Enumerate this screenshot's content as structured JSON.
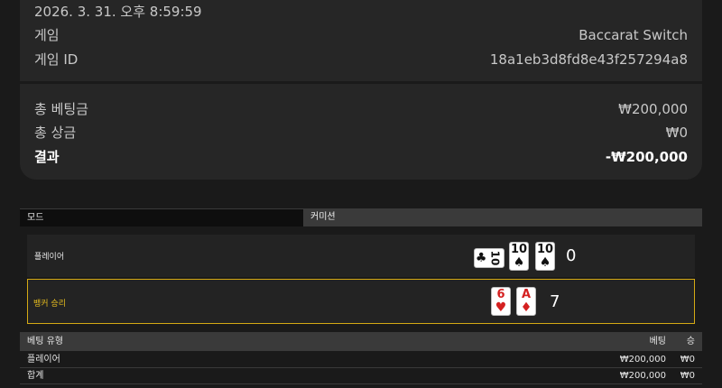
{
  "summary": {
    "datetime": "2026. 3. 31. 오후 8:59:59",
    "game_label": "게임",
    "game_value": "Baccarat Switch",
    "game_id_label": "게임 ID",
    "game_id_value": "18a1eb3d8fd8e43f257294a8"
  },
  "totals": {
    "total_bet_label": "총 베팅금",
    "total_bet_value": "₩200,000",
    "total_win_label": "총 상금",
    "total_win_value": "₩0",
    "result_label": "결과",
    "result_value": "-₩200,000"
  },
  "mode_bar": {
    "mode_label": "모드",
    "commission_label": "커미션"
  },
  "results": {
    "player": {
      "label": "플레이어",
      "score": "0",
      "cards": [
        {
          "rank": "10",
          "suit": "♣",
          "color": "black",
          "rotated": true
        },
        {
          "rank": "10",
          "suit": "♠",
          "color": "black",
          "rotated": false
        },
        {
          "rank": "10",
          "suit": "♠",
          "color": "black",
          "rotated": false
        }
      ]
    },
    "banker": {
      "label": "뱅커 승리",
      "score": "7",
      "cards": [
        {
          "rank": "6",
          "suit": "♥",
          "color": "red",
          "rotated": false
        },
        {
          "rank": "A",
          "suit": "♦",
          "color": "red",
          "rotated": false
        }
      ]
    }
  },
  "bets_table": {
    "headers": {
      "type": "베팅 유형",
      "bet": "베팅",
      "win": "승"
    },
    "rows": [
      {
        "type": "플레이어",
        "bet": "₩200,000",
        "win": "₩0"
      },
      {
        "type": "합계",
        "bet": "₩200,000",
        "win": "₩0"
      }
    ]
  },
  "colors": {
    "background": "#1a1a1a",
    "panel": "#262626",
    "banker_highlight": "#d4a914",
    "red_suit": "#d42020"
  }
}
